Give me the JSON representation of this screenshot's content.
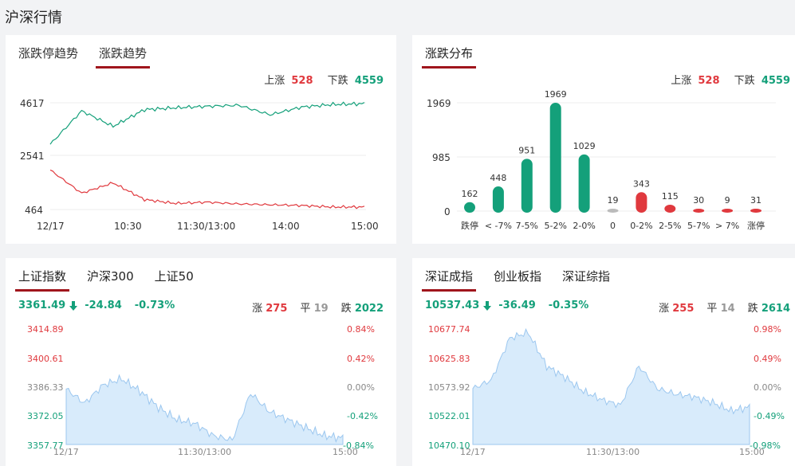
{
  "page_title": "沪深行情",
  "trend_card": {
    "tabs": [
      "涨跌停趋势",
      "涨跌趋势"
    ],
    "up_label": "上涨",
    "up_value": "528",
    "down_label": "下跌",
    "down_value": "4559",
    "y_ticks": [
      "4617",
      "2541",
      "464"
    ],
    "x_ticks": [
      "12/17",
      "10:30",
      "11:30/13:00",
      "14:00",
      "15:00"
    ]
  },
  "dist_card": {
    "tab": "涨跌分布",
    "up_label": "上涨",
    "up_value": "528",
    "down_label": "下跌",
    "down_value": "4559",
    "y_ticks": [
      "1969",
      "985",
      "0"
    ]
  },
  "sh_card": {
    "tabs": [
      "上证指数",
      "沪深300",
      "上证50"
    ],
    "price": "3361.49",
    "change": "-24.84",
    "pct": "-0.73%",
    "rise_label": "涨",
    "rise": "275",
    "flat_label": "平",
    "flat": "19",
    "fall_label": "跌",
    "fall": "2022",
    "y_left": [
      "3414.89",
      "3400.61",
      "3386.33",
      "3372.05",
      "3357.77"
    ],
    "y_right": [
      "0.84%",
      "0.42%",
      "0.00%",
      "-0.42%",
      "-0.84%"
    ],
    "x_ticks": [
      "12/17",
      "11:30/13:00",
      "15:00"
    ]
  },
  "sz_card": {
    "tabs": [
      "深证成指",
      "创业板指",
      "深证综指"
    ],
    "price": "10537.43",
    "change": "-36.49",
    "pct": "-0.35%",
    "rise_label": "涨",
    "rise": "255",
    "flat_label": "平",
    "flat": "14",
    "fall_label": "跌",
    "fall": "2614",
    "y_left": [
      "10677.74",
      "10625.83",
      "10573.92",
      "10522.01",
      "10470.10"
    ],
    "y_right": [
      "0.98%",
      "0.49%",
      "0.00%",
      "-0.49%",
      "-0.98%"
    ],
    "x_ticks": [
      "12/17",
      "11:30/13:00",
      "15:00"
    ]
  },
  "colors": {
    "red": "#e0393e",
    "green": "#14a07a",
    "accent": "#a0151c",
    "area": "#d8ebfb"
  },
  "chart_data": [
    {
      "type": "line",
      "x": [
        "12/17",
        "10:30",
        "11:30/13:00",
        "14:00",
        "15:00"
      ],
      "series": [
        {
          "name": "下跌",
          "values": [
            3000,
            4300,
            3700,
            4350,
            4420,
            4480,
            4520,
            4150,
            4450,
            4550,
            4580
          ]
        },
        {
          "name": "上涨",
          "values": [
            2000,
            1100,
            1500,
            850,
            700,
            750,
            680,
            650,
            620,
            560,
            560
          ]
        }
      ],
      "ylim": [
        464,
        4617
      ]
    },
    {
      "type": "bar",
      "categories": [
        "跌停",
        "< -7%",
        "7-5%",
        "5-2%",
        "2-0%",
        "0",
        "0-2%",
        "2-5%",
        "5-7%",
        "> 7%",
        "涨停"
      ],
      "values": [
        162,
        448,
        951,
        1969,
        1029,
        19,
        343,
        115,
        30,
        9,
        31
      ],
      "ylim": [
        0,
        1969
      ]
    },
    {
      "type": "area",
      "x": [
        "12/17",
        "11:30/13:00",
        "15:00"
      ],
      "series": [
        {
          "name": "上证指数",
          "values": [
            3385,
            3378,
            3387,
            3390,
            3384,
            3376,
            3370,
            3368,
            3362,
            3360,
            3383,
            3374,
            3370,
            3366,
            3362,
            3361
          ]
        }
      ],
      "ylim": [
        3357.77,
        3414.89
      ]
    },
    {
      "type": "area",
      "x": [
        "12/17",
        "11:30/13:00",
        "15:00"
      ],
      "series": [
        {
          "name": "深证成指",
          "values": [
            10570,
            10585,
            10660,
            10670,
            10610,
            10590,
            10565,
            10550,
            10540,
            10610,
            10570,
            10560,
            10555,
            10545,
            10530,
            10537
          ]
        }
      ],
      "ylim": [
        10470.1,
        10677.74
      ]
    }
  ]
}
